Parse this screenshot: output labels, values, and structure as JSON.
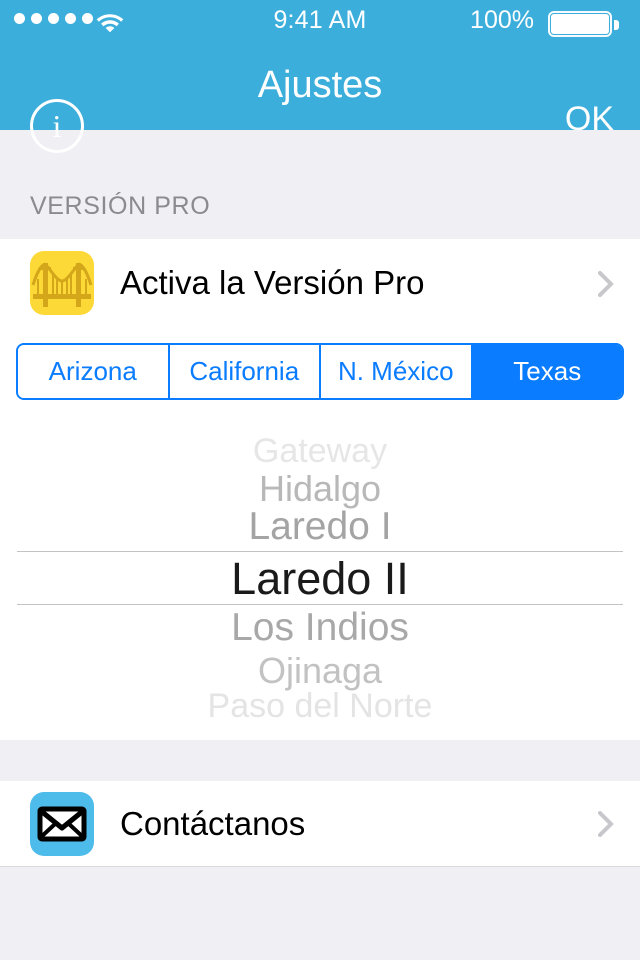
{
  "status_bar": {
    "signal_dots": 5,
    "wifi_icon": "wifi-icon",
    "time": "9:41 AM",
    "battery_percent": "100%",
    "battery_icon": "battery-full-icon"
  },
  "nav_bar": {
    "info_icon": "info-circle-icon",
    "info_glyph": "i",
    "title": "Ajustes",
    "right_button": "OK",
    "background_color": "#3CAEDC"
  },
  "sections": {
    "pro": {
      "header": "VERSIÓN PRO",
      "cell": {
        "icon": "bridge-icon",
        "label": "Activa la Versión Pro",
        "accessory": "chevron-right-icon"
      }
    },
    "contact": {
      "cell": {
        "icon": "envelope-icon",
        "label": "Contáctanos",
        "accessory": "chevron-right-icon"
      }
    }
  },
  "segmented_control": {
    "options": [
      "Arizona",
      "California",
      "N. México",
      "Texas"
    ],
    "selected_index": 3,
    "selected_value": "Texas",
    "tint_color": "#0A7CFF"
  },
  "picker": {
    "label": "border-crossing-picker",
    "selected_value": "Laredo II",
    "selected_index": 3,
    "rows": [
      {
        "label": "Gateway",
        "state": "far-above"
      },
      {
        "label": "Hidalgo",
        "state": "above"
      },
      {
        "label": "Laredo I",
        "state": "near-above"
      },
      {
        "label": "Laredo II",
        "state": "selected"
      },
      {
        "label": "Los Indios",
        "state": "near-below"
      },
      {
        "label": "Ojinaga",
        "state": "below"
      },
      {
        "label": "Paso del Norte",
        "state": "far-below"
      }
    ]
  },
  "colors": {
    "group_background": "#EFEFF4",
    "cell_background": "#FFFFFF",
    "header_text": "#8A8A8F",
    "accent_blue": "#0A7CFF",
    "nav_blue": "#3CAEDC",
    "bridge_icon_bg": "#FCD937",
    "envelope_icon_bg": "#4EBCEA"
  }
}
